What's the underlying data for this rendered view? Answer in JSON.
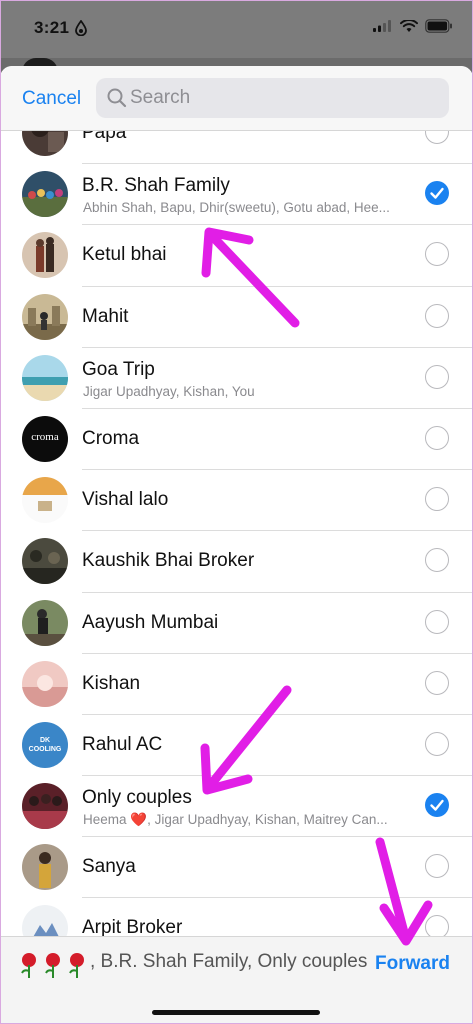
{
  "status": {
    "time": "3:21"
  },
  "header": {
    "cancel_label": "Cancel",
    "search_placeholder": "Search"
  },
  "contacts": [
    {
      "name": "Papa",
      "subtitle": "",
      "selected": false,
      "avatar_color": "#3b2d2a"
    },
    {
      "name": "B.R. Shah Family",
      "subtitle": "Abhin Shah, Bapu, Dhir(sweetu), Gotu abad, Hee...",
      "selected": true,
      "avatar_color": "#3a5a74"
    },
    {
      "name": "Ketul bhai",
      "subtitle": "",
      "selected": false,
      "avatar_color": "#b89c86"
    },
    {
      "name": "Mahit",
      "subtitle": "",
      "selected": false,
      "avatar_color": "#9c8a66"
    },
    {
      "name": "Goa Trip",
      "subtitle": "Jigar Upadhyay, Kishan, You",
      "selected": false,
      "avatar_color": "#8fc7d6"
    },
    {
      "name": "Croma",
      "subtitle": "",
      "selected": false,
      "avatar_color": "#0c0c0c"
    },
    {
      "name": "Vishal lalo",
      "subtitle": "",
      "selected": false,
      "avatar_color": "#e8a64a"
    },
    {
      "name": "Kaushik Bhai  Broker",
      "subtitle": "",
      "selected": false,
      "avatar_color": "#3a3a2e"
    },
    {
      "name": "Aayush Mumbai",
      "subtitle": "",
      "selected": false,
      "avatar_color": "#5d6b4c"
    },
    {
      "name": "Kishan",
      "subtitle": "",
      "selected": false,
      "avatar_color": "#e2b1ad"
    },
    {
      "name": "Rahul AC",
      "subtitle": "",
      "selected": false,
      "avatar_color": "#3a86c8"
    },
    {
      "name": "Only couples",
      "subtitle": "Heema ❤️, Jigar Upadhyay, Kishan, Maitrey Can...",
      "selected": true,
      "avatar_color": "#7a2b34"
    },
    {
      "name": "Sanya",
      "subtitle": "",
      "selected": false,
      "avatar_color": "#8c6a54"
    },
    {
      "name": "Arpit Broker",
      "subtitle": "",
      "selected": false,
      "avatar_color": "#d8dde3"
    }
  ],
  "croma_avatar_text": "croma",
  "rahul_avatar_text": "DK COOLING",
  "bottom": {
    "selected_text": ", B.R. Shah Family, Only couples",
    "forward_label": "Forward"
  },
  "colors": {
    "accent": "#1a82f0",
    "annotation_arrow": "#e11ee6"
  }
}
